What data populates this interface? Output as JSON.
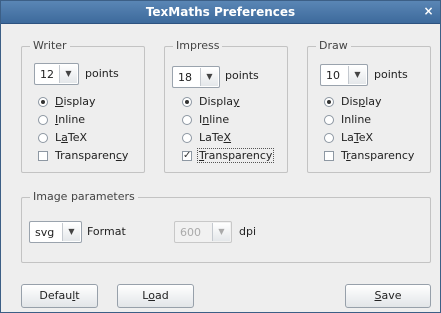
{
  "window": {
    "title": "TexMaths Preferences",
    "close_glyph": "×"
  },
  "writer": {
    "title": "Writer",
    "size": "12",
    "size_unit": "points",
    "options": [
      {
        "label": "Display",
        "mnemonic": "D",
        "type": "radio",
        "checked": true
      },
      {
        "label": "Inline",
        "mnemonic": "I",
        "type": "radio",
        "checked": false
      },
      {
        "label": "LaTeX",
        "mnemonic": "a",
        "type": "radio",
        "checked": false
      },
      {
        "label": "Transparency",
        "mnemonic": "c",
        "type": "checkbox",
        "checked": false
      }
    ]
  },
  "impress": {
    "title": "Impress",
    "size": "18",
    "size_unit": "points",
    "options": [
      {
        "label": "Display",
        "mnemonic": "y",
        "type": "radio",
        "checked": true
      },
      {
        "label": "Inline",
        "mnemonic": "n",
        "type": "radio",
        "checked": false
      },
      {
        "label": "LaTeX",
        "mnemonic": "X",
        "type": "radio",
        "checked": false
      },
      {
        "label": "Transparency",
        "mnemonic": "T",
        "type": "checkbox",
        "checked": true
      }
    ]
  },
  "draw": {
    "title": "Draw",
    "size": "10",
    "size_unit": "points",
    "options": [
      {
        "label": "Display",
        "mnemonic": "p",
        "type": "radio",
        "checked": true
      },
      {
        "label": "Inline",
        "mnemonic": "g",
        "type": "radio",
        "checked": false
      },
      {
        "label": "LaTeX",
        "mnemonic": "T",
        "type": "radio",
        "checked": false
      },
      {
        "label": "Transparency",
        "mnemonic": "r",
        "type": "checkbox",
        "checked": false
      }
    ]
  },
  "image": {
    "title": "Image parameters",
    "format_value": "svg",
    "format_label": "Format",
    "dpi_value": "600",
    "dpi_label": "dpi"
  },
  "buttons": {
    "default": "Default",
    "load": "Load",
    "save": "Save"
  },
  "icons": {
    "dropdown": "chevron-down-icon",
    "close": "close-icon",
    "check": "check-icon"
  }
}
